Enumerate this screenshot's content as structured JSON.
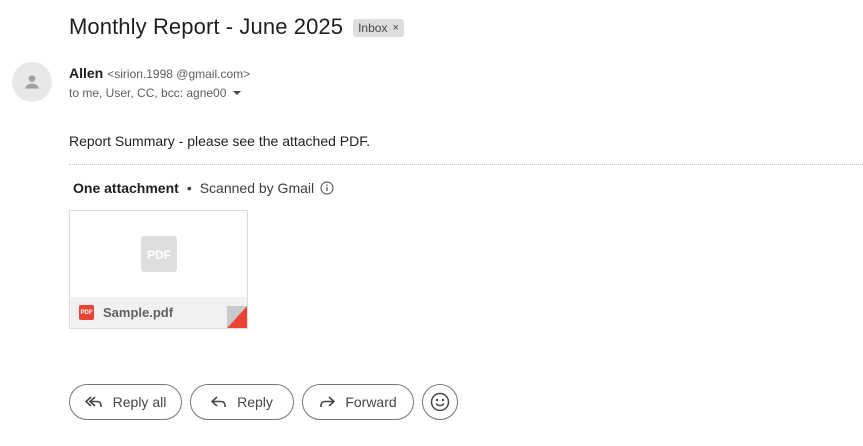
{
  "email": {
    "subject": "Monthly Report - June 2025",
    "label_chip": "Inbox",
    "label_close": "×",
    "sender_name": "Allen",
    "sender_email": "<sirion.1998       @gmail.com>",
    "recipients": "to me, User, CC, bcc: agne00",
    "body": "Report Summary - please see the attached PDF."
  },
  "attachments": {
    "count_label": "One attachment",
    "separator": "•",
    "scanned_label": "Scanned by Gmail",
    "items": [
      {
        "file_name": "Sample.pdf",
        "type_badge": "PDF",
        "preview_label": "PDF"
      }
    ]
  },
  "actions": {
    "reply_all": "Reply all",
    "reply": "Reply",
    "forward": "Forward"
  },
  "colors": {
    "pdf_red": "#ea4335",
    "chip_bg": "#dddddd",
    "button_border": "#747775"
  }
}
